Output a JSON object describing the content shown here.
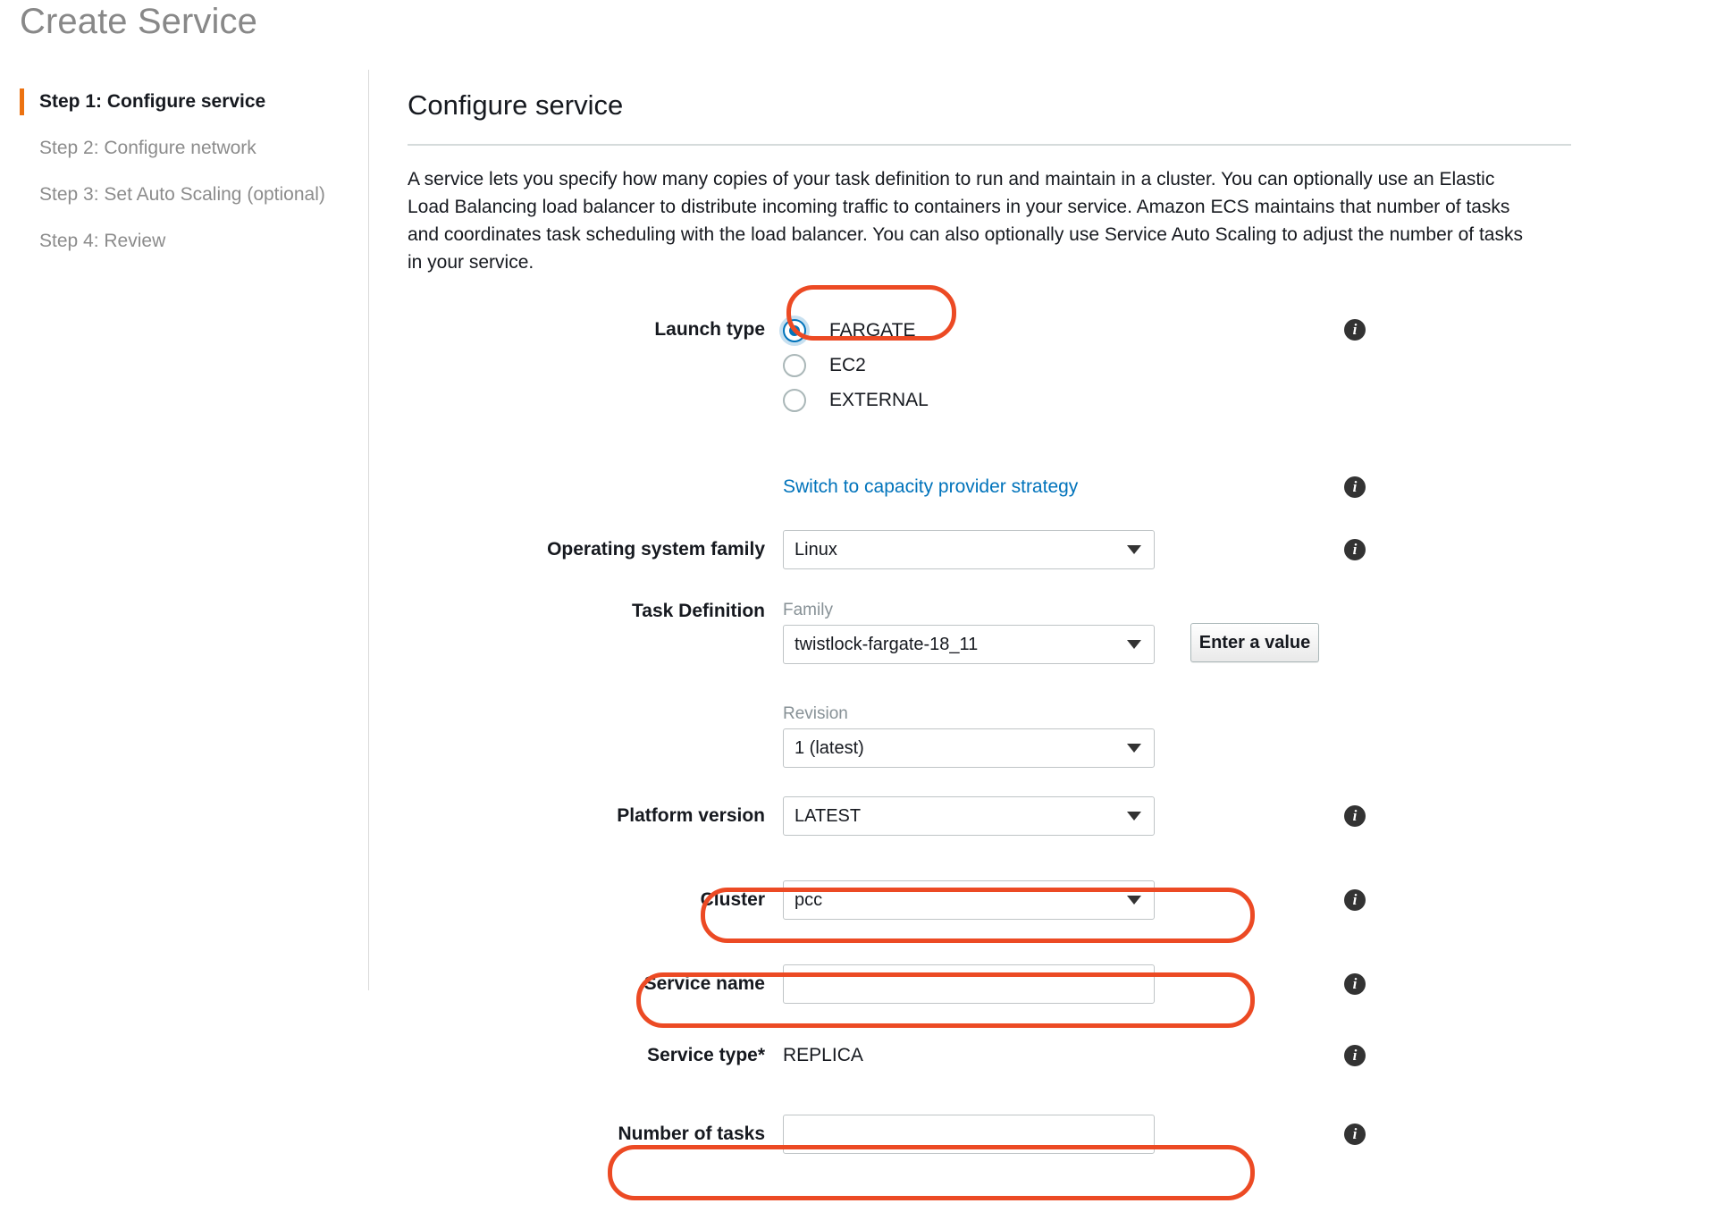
{
  "header": {
    "title": "Create Service"
  },
  "sidebar": {
    "items": [
      {
        "label": "Step 1: Configure service",
        "active": true
      },
      {
        "label": "Step 2: Configure network",
        "active": false
      },
      {
        "label": "Step 3: Set Auto Scaling (optional)",
        "active": false
      },
      {
        "label": "Step 4: Review",
        "active": false
      }
    ]
  },
  "main": {
    "section_title": "Configure service",
    "intro": "A service lets you specify how many copies of your task definition to run and maintain in a cluster. You can optionally use an Elastic Load Balancing load balancer to distribute incoming traffic to containers in your service. Amazon ECS maintains that number of tasks and coordinates task scheduling with the load balancer. You can also optionally use Service Auto Scaling to adjust the number of tasks in your service."
  },
  "form": {
    "launch_type": {
      "label": "Launch type",
      "options": [
        {
          "label": "FARGATE",
          "selected": true
        },
        {
          "label": "EC2",
          "selected": false
        },
        {
          "label": "EXTERNAL",
          "selected": false
        }
      ]
    },
    "capacity_provider_link": "Switch to capacity provider strategy",
    "operating_system_family": {
      "label": "Operating system family",
      "value": "Linux"
    },
    "task_definition": {
      "label": "Task Definition",
      "family_sublabel": "Family",
      "family_value": "twistlock-fargate-18_11",
      "revision_sublabel": "Revision",
      "revision_value": "1 (latest)",
      "enter_value_button": "Enter a value"
    },
    "platform_version": {
      "label": "Platform version",
      "value": "LATEST"
    },
    "cluster": {
      "label": "Cluster",
      "value": "pcc"
    },
    "service_name": {
      "label": "Service name",
      "value": "",
      "placeholder": ""
    },
    "service_type": {
      "label": "Service type*",
      "value": "REPLICA"
    },
    "number_of_tasks": {
      "label": "Number of tasks",
      "value": "",
      "placeholder": ""
    },
    "info_icon_glyph": "i"
  },
  "annotations": {
    "color": "#ec4a24",
    "highlighted_fields": [
      "launch-type-fargate",
      "cluster",
      "service-name",
      "number-of-tasks"
    ]
  },
  "colors": {
    "accent_orange": "#ec7211",
    "link_blue": "#0073bb",
    "radio_blue": "#0073bb",
    "annotation_red": "#ec4a24",
    "title_gray": "#888888"
  }
}
